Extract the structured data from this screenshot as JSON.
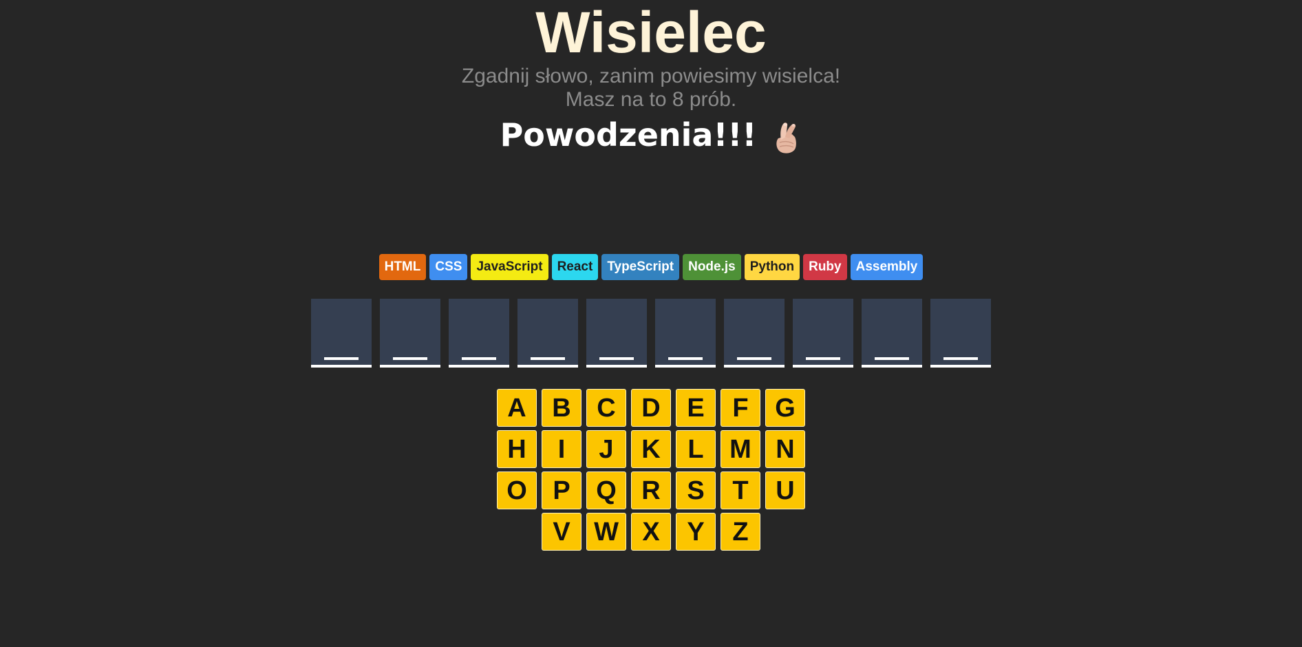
{
  "header": {
    "title": "Wisielec",
    "subtitle_line1": "Zgadnij słowo, zanim powiesimy wisielca!",
    "subtitle_line2": "Masz na to 8 prób.",
    "good_luck": "Powodzenia!!!",
    "good_luck_icon": "crossed-fingers-icon"
  },
  "languages": [
    {
      "label": "HTML",
      "bg": "#e2680f",
      "fg": "#ffffff"
    },
    {
      "label": "CSS",
      "bg": "#3f8ef0",
      "fg": "#ffffff"
    },
    {
      "label": "JavaScript",
      "bg": "#f4eb13",
      "fg": "#1e1e1e"
    },
    {
      "label": "React",
      "bg": "#2cd7ef",
      "fg": "#1e1e1e"
    },
    {
      "label": "TypeScript",
      "bg": "#3382bf",
      "fg": "#ffffff"
    },
    {
      "label": "Node.js",
      "bg": "#4e9137",
      "fg": "#ffffff"
    },
    {
      "label": "Python",
      "bg": "#ffd742",
      "fg": "#1e1e1e"
    },
    {
      "label": "Ruby",
      "bg": "#d13845",
      "fg": "#ffffff"
    },
    {
      "label": "Assembly",
      "bg": "#3f8ef0",
      "fg": "#ffffff"
    }
  ],
  "word": {
    "letters": [
      "",
      "",
      "",
      "",
      "",
      "",
      "",
      "",
      "",
      ""
    ]
  },
  "keyboard": {
    "rows": [
      [
        "A",
        "B",
        "C",
        "D",
        "E",
        "F",
        "G"
      ],
      [
        "H",
        "I",
        "J",
        "K",
        "L",
        "M",
        "N"
      ],
      [
        "O",
        "P",
        "Q",
        "R",
        "S",
        "T",
        "U"
      ],
      [
        "V",
        "W",
        "X",
        "Y",
        "Z"
      ]
    ]
  },
  "colors": {
    "background": "#262626",
    "title": "#fef3d8",
    "key": "#fcc500",
    "slot": "#353f51"
  }
}
